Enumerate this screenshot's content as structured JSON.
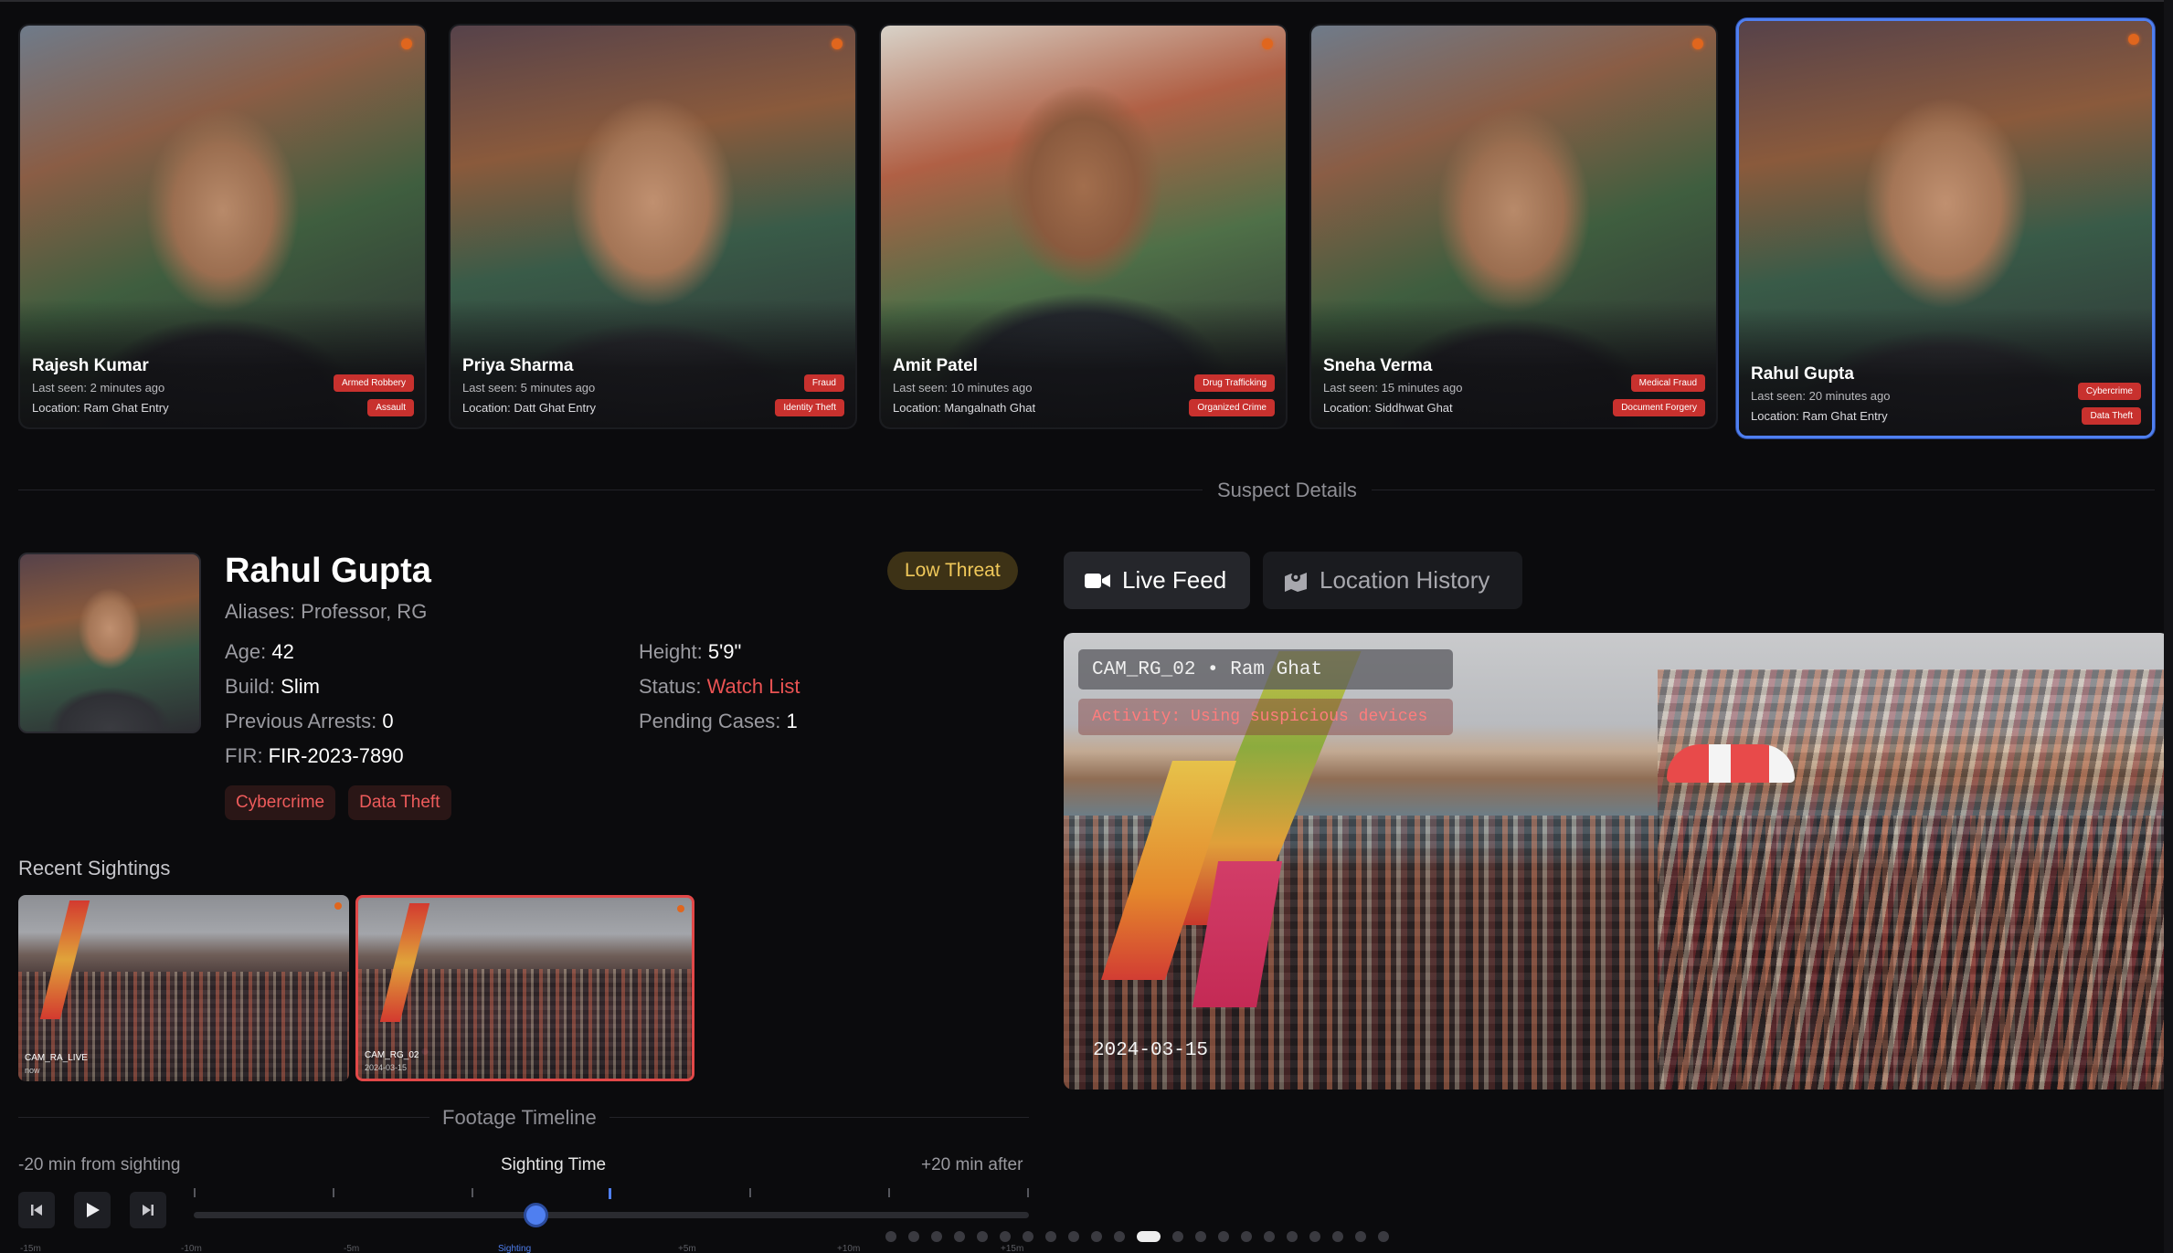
{
  "suspects": [
    {
      "name": "Rajesh Kumar",
      "last_seen": "Last seen: 2 minutes ago",
      "location": "Location: Ram Ghat Entry",
      "tags": [
        "Armed Robbery",
        "Assault"
      ]
    },
    {
      "name": "Priya Sharma",
      "last_seen": "Last seen: 5 minutes ago",
      "location": "Location: Datt Ghat Entry",
      "tags": [
        "Fraud",
        "Identity Theft"
      ]
    },
    {
      "name": "Amit Patel",
      "last_seen": "Last seen: 10 minutes ago",
      "location": "Location: Mangalnath Ghat",
      "tags": [
        "Drug Trafficking",
        "Organized Crime"
      ]
    },
    {
      "name": "Sneha Verma",
      "last_seen": "Last seen: 15 minutes ago",
      "location": "Location: Siddhwat Ghat",
      "tags": [
        "Medical Fraud",
        "Document Forgery"
      ]
    },
    {
      "name": "Rahul Gupta",
      "last_seen": "Last seen: 20 minutes ago",
      "location": "Location: Ram Ghat Entry",
      "tags": [
        "Cybercrime",
        "Data Theft"
      ]
    }
  ],
  "details": {
    "section_title": "Suspect Details",
    "name": "Rahul Gupta",
    "aliases": "Aliases: Professor, RG",
    "threat": "Low Threat",
    "age_label": "Age: ",
    "age": "42",
    "build_label": "Build: ",
    "build": "Slim",
    "arrests_label": "Previous Arrests: ",
    "arrests": "0",
    "fir_label": "FIR: ",
    "fir": "FIR-2023-7890",
    "height_label": "Height: ",
    "height": "5'9\"",
    "status_label": "Status: ",
    "status": "Watch List",
    "pending_label": "Pending Cases: ",
    "pending": "1",
    "tags": [
      "Cybercrime",
      "Data Theft"
    ]
  },
  "sightings": {
    "title": "Recent Sightings",
    "items": [
      {
        "camera": "CAM_RA_LIVE",
        "time": "now"
      },
      {
        "camera": "CAM_RG_02",
        "time": "2024-03-15"
      }
    ]
  },
  "timeline": {
    "title": "Footage Timeline",
    "left_label": "-20 min from sighting",
    "center_label": "Sighting Time",
    "right_label": "+20 min after",
    "position": 0.41,
    "scale_labels": [
      "-15m",
      "-10m",
      "-5m",
      "Sighting",
      "+5m",
      "+10m",
      "+15m"
    ]
  },
  "feed": {
    "tab_live": "Live Feed",
    "tab_history": "Location History",
    "camera": "CAM_RG_02 • Ram Ghat",
    "activity": "Activity: Using suspicious devices",
    "date": "2024-03-15"
  },
  "pager": {
    "count": 22,
    "active": 11
  },
  "colors": {
    "accent": "#4f7ff0",
    "danger": "#c8312e",
    "threat_text": "#f0c85a",
    "status": "#ea5353"
  },
  "icons": {
    "play": "play-icon",
    "prev": "skip-back-icon",
    "next": "skip-forward-icon",
    "video": "video-camera-icon",
    "map": "map-pin-icon"
  }
}
